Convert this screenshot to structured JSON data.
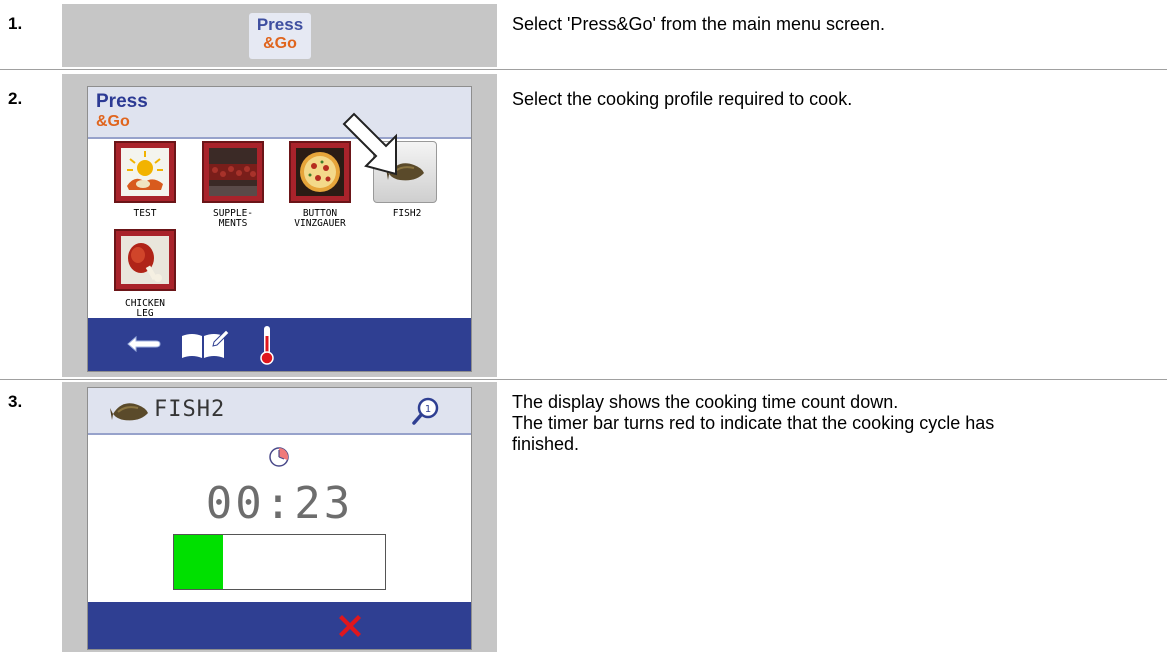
{
  "steps": [
    {
      "number": "1.",
      "text": "Select 'Press&Go' from the main menu screen."
    },
    {
      "number": "2.",
      "text": "Select the cooking profile required to cook."
    },
    {
      "number": "3.",
      "text_lines": [
        "The display shows the cooking time count down.",
        "The timer bar turns red to indicate that the cooking cycle has",
        "finished."
      ]
    }
  ],
  "logo": {
    "line1": "Press",
    "line2": "&Go"
  },
  "profile_screen": {
    "title_line1": "Press",
    "title_line2": "&Go",
    "profiles": [
      {
        "label_lines": [
          "TEST"
        ]
      },
      {
        "label_lines": [
          "SUPPLE-",
          "MENTS"
        ]
      },
      {
        "label_lines": [
          "BUTTON",
          "VINZGAUER"
        ]
      },
      {
        "label_lines": [
          "FISH2"
        ]
      },
      {
        "label_lines": [
          "CHICKEN",
          "LEG"
        ]
      }
    ],
    "bottom_icons": [
      "back-arrow-icon",
      "recipe-book-icon",
      "thermometer-icon"
    ]
  },
  "cooking_screen": {
    "profile_name": "FISH2",
    "timer": "00:23",
    "progress_fraction": 0.23,
    "progress_color": "#00e000",
    "header_icons": [
      "fish-icon",
      "magnifier-icon"
    ],
    "clock_icon": "clock-icon",
    "cancel_icon": "cancel-x-icon"
  },
  "colors": {
    "accent_blue": "#2f3f92",
    "cancel_red": "#e0161d",
    "grey_panel": "#c6c6c6"
  }
}
